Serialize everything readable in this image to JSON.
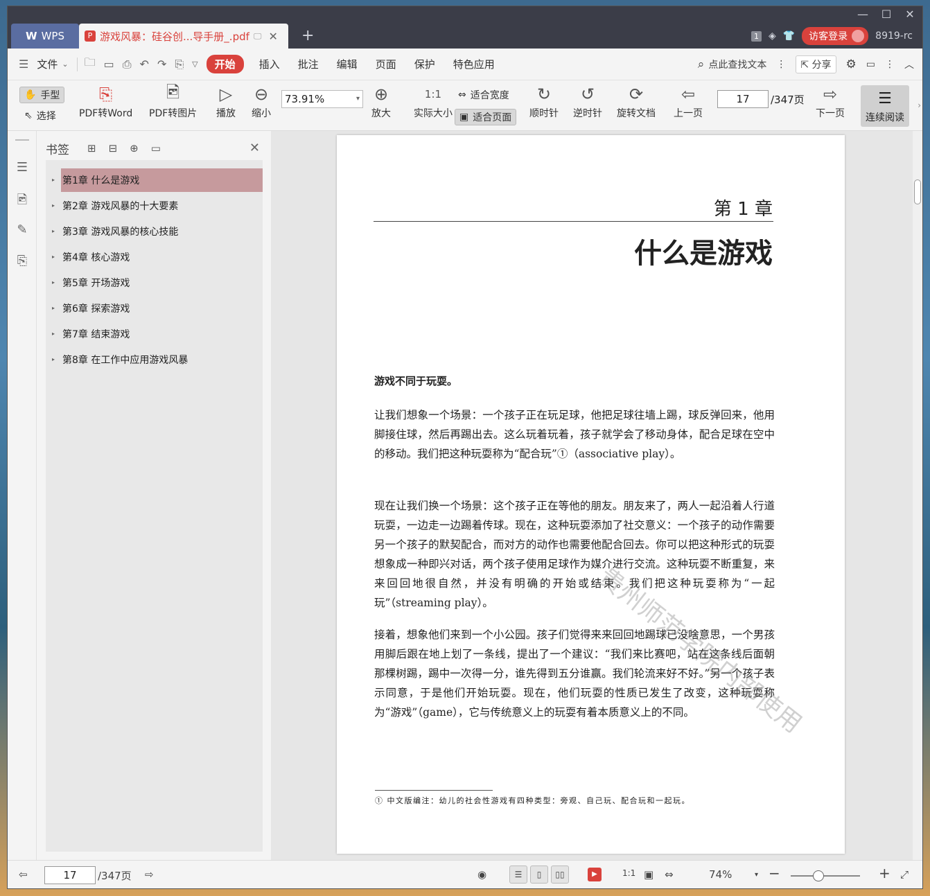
{
  "titlebar": {
    "app_tab": "WPS",
    "doc_tab": "游戏风暴：硅谷创...导手册_.pdf",
    "badge_count": "1",
    "login_label": "访客登录",
    "user_name": "8919-rc"
  },
  "menubar": {
    "file": "文件",
    "tabs": [
      "开始",
      "插入",
      "批注",
      "编辑",
      "页面",
      "保护",
      "特色应用"
    ],
    "search": "点此查找文本",
    "share": "分享"
  },
  "ribbon": {
    "hand": "手型",
    "select": "选择",
    "pdf_to_word": "PDF转Word",
    "pdf_to_image": "PDF转图片",
    "play": "播放",
    "zoom_out": "缩小",
    "zoom_value": "73.91%",
    "zoom_in": "放大",
    "actual_size": "实际大小",
    "fit_width": "适合宽度",
    "fit_page": "适合页面",
    "clockwise": "顺时针",
    "counterclockwise": "逆时针",
    "rotate_doc": "旋转文档",
    "prev_page": "上一页",
    "current_page": "17",
    "total_pages": "/347页",
    "next_page": "下一页",
    "continuous_read": "连续阅读"
  },
  "bookmarks": {
    "title": "书签",
    "items": [
      "第1章 什么是游戏",
      "第2章 游戏风暴的十大要素",
      "第3章 游戏风暴的核心技能",
      "第4章 核心游戏",
      "第5章 开场游戏",
      "第6章 探索游戏",
      "第7章 结束游戏",
      "第8章 在工作中应用游戏风暴"
    ]
  },
  "page": {
    "chapter_no": "第 1 章",
    "chapter_title": "什么是游戏",
    "lead": "游戏不同于玩耍。",
    "p1": "让我们想象一个场景：一个孩子正在玩足球，他把足球往墙上踢，球反弹回来，他用脚接住球，然后再踢出去。这么玩着玩着，孩子就学会了移动身体，配合足球在空中的移动。我们把这种玩耍称为“配合玩”①（associative play）。",
    "p2": "现在让我们换一个场景：这个孩子正在等他的朋友。朋友来了，两人一起沿着人行道玩耍，一边走一边踢着传球。现在，这种玩耍添加了社交意义：一个孩子的动作需要另一个孩子的默契配合，而对方的动作也需要他配合回去。你可以把这种形式的玩耍想象成一种即兴对话，两个孩子使用足球作为媒介进行交流。这种玩耍不断重复，来来回回地很自然，并没有明确的开始或结束。我们把这种玩耍称为“一起玩”（streaming play）。",
    "p3": "接着，想象他们来到一个小公园。孩子们觉得来来回回地踢球已没啥意思，一个男孩用脚后跟在地上划了一条线，提出了一个建议：“我们来比赛吧，站在这条线后面朝那棵树踢，踢中一次得一分，谁先得到五分谁赢。我们轮流来好不好。”另一个孩子表示同意，于是他们开始玩耍。现在，他们玩耍的性质已发生了改变，这种玩耍称为“游戏”（game），它与传统意义上的玩耍有着本质意义上的不同。",
    "footnote": "①  中文版编注：幼儿的社会性游戏有四种类型：旁观、自己玩、配合玩和一起玩。",
    "watermark": "贵州师范学院内部使用"
  },
  "statusbar": {
    "current_page": "17",
    "total_pages": "/347页",
    "zoom": "74%"
  }
}
